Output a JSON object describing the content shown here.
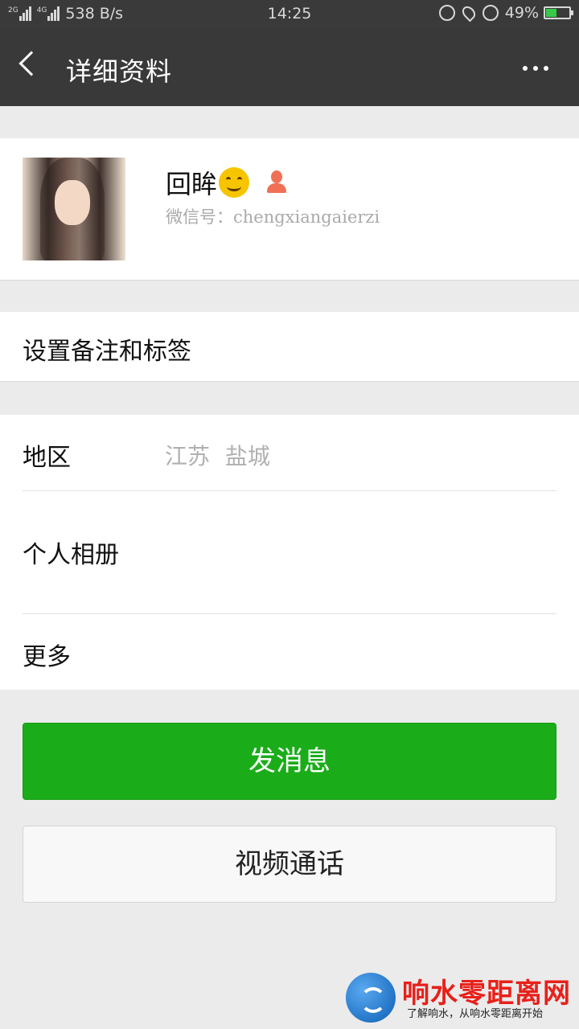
{
  "status_bar": {
    "network_2g": "2G",
    "network_4g": "4G",
    "speed": "538 B/s",
    "time": "14:25",
    "battery": "49%",
    "battery_level": 0.49
  },
  "nav": {
    "title": "详细资料"
  },
  "profile": {
    "nickname": "回眸",
    "wechat_id": "微信号：chengxiangaierzi"
  },
  "remark": {
    "label": "设置备注和标签"
  },
  "info": {
    "region_label": "地区",
    "region_value": "江苏  盐城",
    "album_label": "个人相册",
    "more_label": "更多"
  },
  "actions": {
    "send_message": "发消息",
    "video_call": "视频通话"
  },
  "watermark": {
    "title": "响水零距离网",
    "subtitle": "了解响水，从响水零距离开始"
  },
  "colors": {
    "primary_green": "#1aad19",
    "nav_bg": "#393939",
    "gender_icon": "#f07055"
  }
}
